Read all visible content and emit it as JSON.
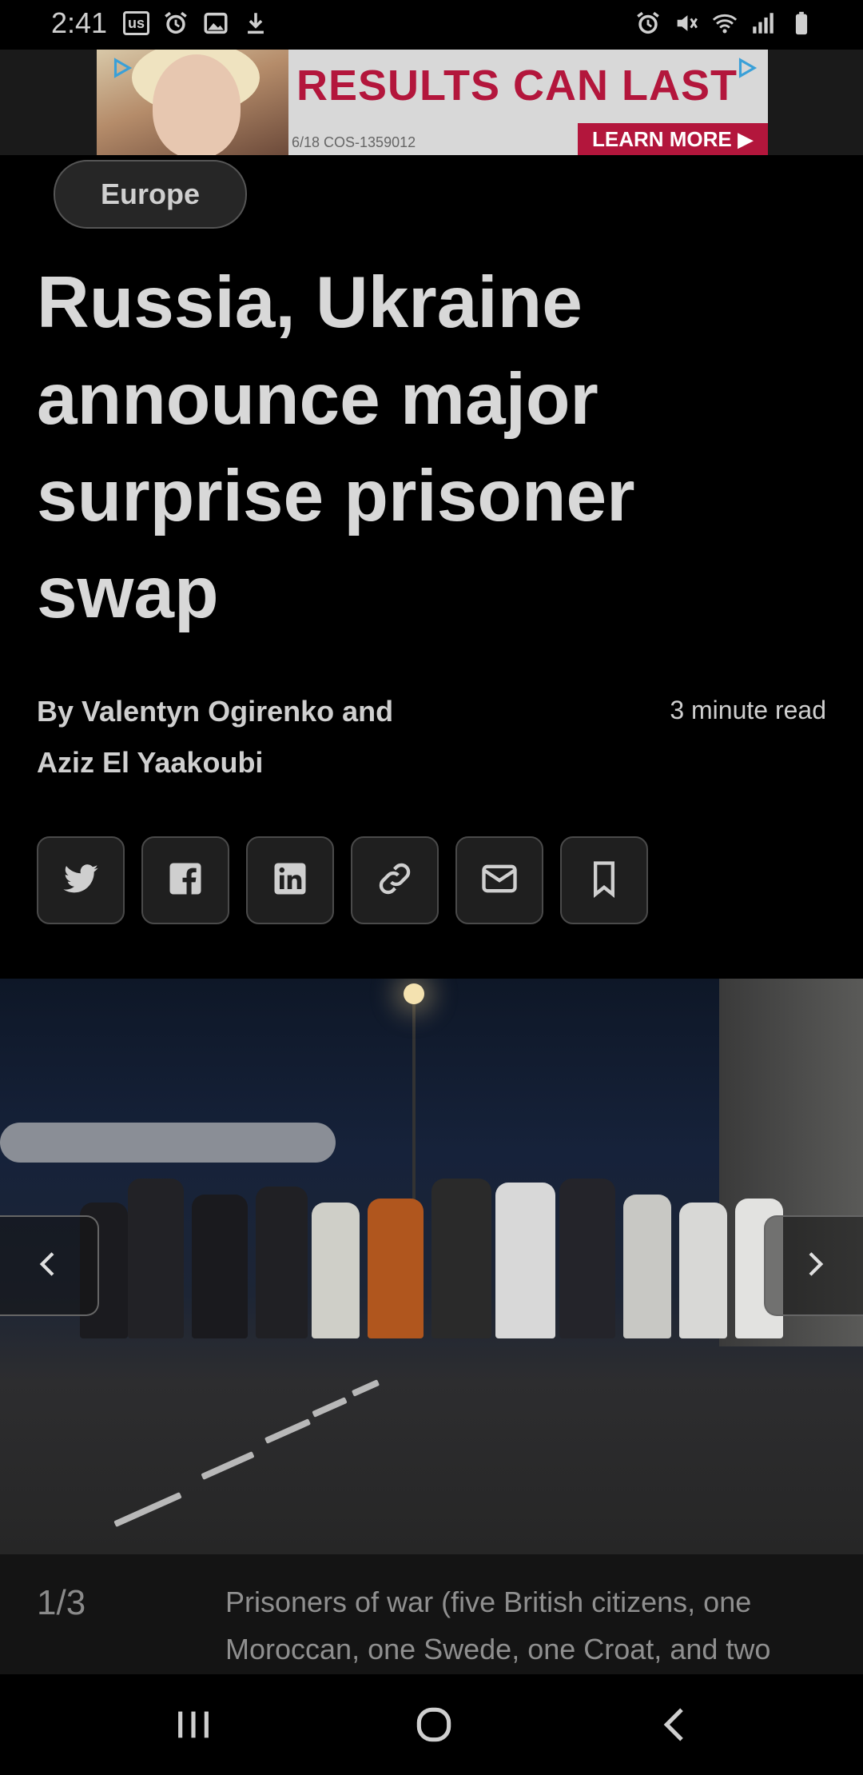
{
  "status_bar": {
    "time": "2:41",
    "left_icons": [
      "us-badge",
      "alarm-icon",
      "image-icon",
      "download-icon"
    ],
    "us_badge": "us",
    "right_icons": [
      "alarm-icon",
      "mute-icon",
      "wifi-icon",
      "signal-icon",
      "battery-icon"
    ]
  },
  "ad": {
    "headline": "RESULTS CAN LAST",
    "fine_print": "6/18   COS-1359012",
    "cta": "LEARN MORE ▶",
    "accent": "#b3163c"
  },
  "article": {
    "category": "Europe",
    "headline": "Russia, Ukraine announce major surprise prisoner swap",
    "byline": "By Valentyn Ogirenko and Aziz El Yaakoubi",
    "read_time": "3 minute read"
  },
  "share": [
    "twitter-icon",
    "facebook-icon",
    "linkedin-icon",
    "link-icon",
    "email-icon",
    "bookmark-icon"
  ],
  "gallery": {
    "counter": "1/3",
    "caption": "Prisoners of war (five British citizens, one Moroccan, one Swede, one Croat, and two"
  },
  "navbar": [
    "recents-button",
    "home-button",
    "back-button"
  ]
}
